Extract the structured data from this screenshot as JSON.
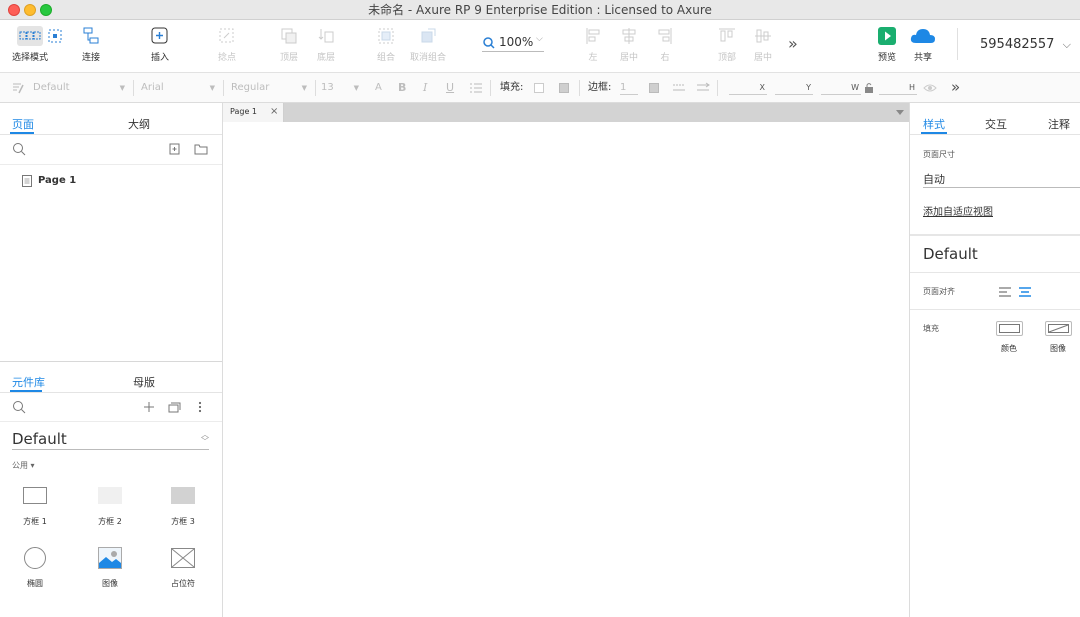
{
  "window": {
    "title": "未命名 - Axure RP 9 Enterprise Edition : Licensed to Axure"
  },
  "toolbar": {
    "select_mode": "选择模式",
    "connect": "连接",
    "insert": "插入",
    "points": "捻点",
    "top_layer": "顶层",
    "bottom_layer": "底层",
    "group": "组合",
    "ungroup": "取消组合",
    "zoom": "100%",
    "align_left": "左",
    "align_center": "居中",
    "align_right": "右",
    "align_top": "顶部",
    "align_middle": "居中",
    "more": "»",
    "preview": "预览",
    "share": "共享",
    "account": "595482557"
  },
  "format_bar": {
    "style": "Default",
    "font": "Arial",
    "weight": "Regular",
    "size": "13",
    "fill_label": "填充:",
    "border_label": "边框:",
    "border_width": "1",
    "x_label": "X",
    "y_label": "Y",
    "w_label": "W",
    "h_label": "H",
    "more": "»"
  },
  "pages_panel": {
    "tab_pages": "页面",
    "tab_outline": "大纲",
    "items": [
      {
        "label": "Page 1"
      }
    ]
  },
  "library_panel": {
    "tab_library": "元件库",
    "tab_masters": "母版",
    "library_name": "Default",
    "section": "公用 ▾",
    "widgets": [
      {
        "label": "方框 1"
      },
      {
        "label": "方框 2"
      },
      {
        "label": "方框 3"
      },
      {
        "label": "椭圆"
      },
      {
        "label": "图像"
      },
      {
        "label": "占位符"
      }
    ]
  },
  "canvas": {
    "tab_label": "Page 1",
    "tab_close": "×"
  },
  "inspector": {
    "tab_style": "样式",
    "tab_interaction": "交互",
    "tab_notes": "注释",
    "page_size_label": "页面尺寸",
    "page_size_value": "自动",
    "adaptive_link": "添加自适应视图",
    "style_name": "Default",
    "page_align_label": "页面对齐",
    "fill_label": "填充",
    "fill_color": "颜色",
    "fill_image": "图像"
  },
  "colors": {
    "accent": "#1e88e5",
    "preview_green": "#1aae6f",
    "cloud_blue": "#1e88e5"
  }
}
